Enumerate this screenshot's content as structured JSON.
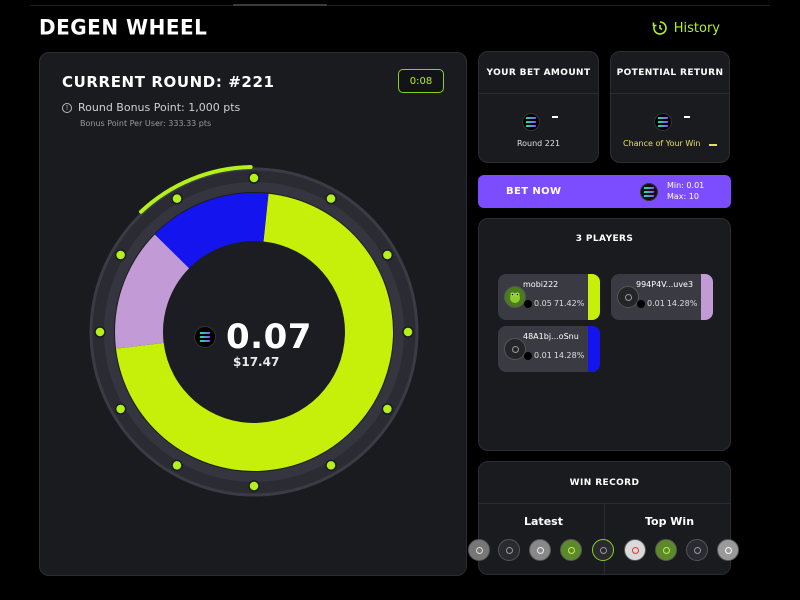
{
  "app": {
    "title": "DEGEN WHEEL",
    "history_label": "History"
  },
  "round": {
    "title": "CURRENT ROUND:",
    "number": "#221",
    "timer": "0:08",
    "bonus_label": "Round Bonus Point: 1,000 pts",
    "bonus_per_user": "Bonus Point Per User: 333.33 pts",
    "progress_fraction": 0.12
  },
  "wheel": {
    "pot_amount": "0.07",
    "pot_usd": "$17.47",
    "segments": [
      {
        "player": "mobi222",
        "share": 0.7142,
        "color": "#c6f00a"
      },
      {
        "player": "994P4V...uve3",
        "share": 0.1428,
        "color": "#c29bd6"
      },
      {
        "player": "48A1bj...oSnu",
        "share": 0.1428,
        "color": "#1414ee"
      }
    ],
    "accent": "#b4f11a"
  },
  "your_bet": {
    "title": "YOUR BET AMOUNT",
    "round_label": "Round 221"
  },
  "potential_return": {
    "title": "POTENTIAL RETURN",
    "chance_label": "Chance of Your Win"
  },
  "bet_button": {
    "label": "BET NOW",
    "min": "Min: 0.01",
    "max": "Max: 10"
  },
  "players": {
    "title": "3 PLAYERS",
    "list": [
      {
        "name": "mobi222",
        "amount": "0.05",
        "percent": "71.42%",
        "color": "#c6f00a",
        "avatar": "frog-avatar"
      },
      {
        "name": "994P4V...uve3",
        "amount": "0.01",
        "percent": "14.28%",
        "color": "#c29bd6",
        "avatar": "default-avatar"
      },
      {
        "name": "48A1bj...oSnu",
        "amount": "0.01",
        "percent": "14.28%",
        "color": "#1414ee",
        "avatar": "default-avatar"
      }
    ]
  },
  "win_record": {
    "title": "WIN RECORD",
    "latest_label": "Latest",
    "top_label": "Top Win"
  }
}
